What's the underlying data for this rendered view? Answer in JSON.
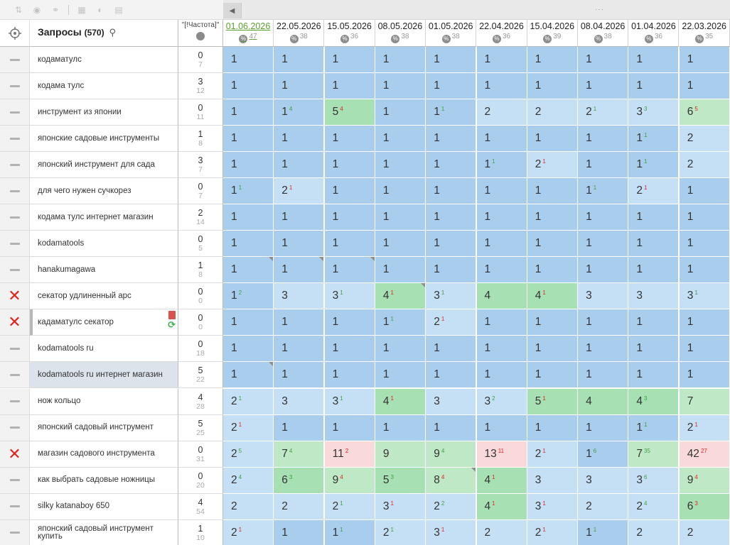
{
  "header": {
    "query_title": "Запросы",
    "query_count": "(570)",
    "freq_label": "\"[!Частота]\""
  },
  "dates": [
    {
      "label": "01.06.2026",
      "sub": "47",
      "active": true
    },
    {
      "label": "22.05.2026",
      "sub": "38"
    },
    {
      "label": "15.05.2026",
      "sub": "36"
    },
    {
      "label": "08.05.2026",
      "sub": "38"
    },
    {
      "label": "01.05.2026",
      "sub": "38"
    },
    {
      "label": "22.04.2026",
      "sub": "36"
    },
    {
      "label": "15.04.2026",
      "sub": "39"
    },
    {
      "label": "08.04.2026",
      "sub": "38"
    },
    {
      "label": "01.04.2026",
      "sub": "36"
    },
    {
      "label": "22.03.2026",
      "sub": "35"
    }
  ],
  "pct_symbol": "%",
  "colors": {
    "blue_dark": "#a9cdec",
    "blue_light": "#c5e0f5",
    "green": "#a7e0b3",
    "pink": "#f9d9d9",
    "active_date": "#5aa02c",
    "delete": "#e0211d"
  },
  "rows": [
    {
      "mark": "dash",
      "query": "кодаматулс",
      "f1": "0",
      "f2": "7",
      "cells": [
        [
          "1",
          "",
          "",
          "b1"
        ],
        [
          "1",
          "",
          "",
          "b1"
        ],
        [
          "1",
          "",
          "",
          "b1"
        ],
        [
          "1",
          "",
          "",
          "b1"
        ],
        [
          "1",
          "",
          "",
          "b1"
        ],
        [
          "1",
          "",
          "",
          "b1"
        ],
        [
          "1",
          "",
          "",
          "b1"
        ],
        [
          "1",
          "",
          "",
          "b1"
        ],
        [
          "1",
          "",
          "",
          "b1"
        ],
        [
          "1",
          "",
          "",
          "b1"
        ]
      ]
    },
    {
      "mark": "dash",
      "query": "кодама тулс",
      "f1": "3",
      "f2": "12",
      "cells": [
        [
          "1",
          "",
          "",
          "b1"
        ],
        [
          "1",
          "",
          "",
          "b1"
        ],
        [
          "1",
          "",
          "",
          "b1"
        ],
        [
          "1",
          "",
          "",
          "b1"
        ],
        [
          "1",
          "",
          "",
          "b1"
        ],
        [
          "1",
          "",
          "",
          "b1"
        ],
        [
          "1",
          "",
          "",
          "b1"
        ],
        [
          "1",
          "",
          "",
          "b1"
        ],
        [
          "1",
          "",
          "",
          "b1"
        ],
        [
          "1",
          "",
          "",
          "b1"
        ]
      ]
    },
    {
      "mark": "dash",
      "query": "инструмент из японии",
      "f1": "0",
      "f2": "11",
      "cells": [
        [
          "1",
          "",
          "",
          "b1"
        ],
        [
          "1",
          "4",
          "up",
          "b1"
        ],
        [
          "5",
          "4",
          "dn",
          "g1"
        ],
        [
          "1",
          "",
          "",
          "b1"
        ],
        [
          "1",
          "1",
          "up",
          "b1"
        ],
        [
          "2",
          "",
          "",
          "b3"
        ],
        [
          "2",
          "",
          "",
          "b3"
        ],
        [
          "2",
          "1",
          "up",
          "b3"
        ],
        [
          "3",
          "3",
          "up",
          "b3"
        ],
        [
          "6",
          "5",
          "dn",
          "g2"
        ]
      ]
    },
    {
      "mark": "dash",
      "query": "японские садовые инструменты",
      "f1": "1",
      "f2": "8",
      "cells": [
        [
          "1",
          "",
          "",
          "b1"
        ],
        [
          "1",
          "",
          "",
          "b1"
        ],
        [
          "1",
          "",
          "",
          "b1"
        ],
        [
          "1",
          "",
          "",
          "b1"
        ],
        [
          "1",
          "",
          "",
          "b1"
        ],
        [
          "1",
          "",
          "",
          "b1"
        ],
        [
          "1",
          "",
          "",
          "b1"
        ],
        [
          "1",
          "",
          "",
          "b1"
        ],
        [
          "1",
          "1",
          "up",
          "b1"
        ],
        [
          "2",
          "",
          "",
          "b3"
        ]
      ]
    },
    {
      "mark": "dash",
      "query": "японский инструмент для сада",
      "f1": "3",
      "f2": "7",
      "cells": [
        [
          "1",
          "",
          "",
          "b1"
        ],
        [
          "1",
          "",
          "",
          "b1"
        ],
        [
          "1",
          "",
          "",
          "b1"
        ],
        [
          "1",
          "",
          "",
          "b1"
        ],
        [
          "1",
          "",
          "",
          "b1"
        ],
        [
          "1",
          "1",
          "up",
          "b1"
        ],
        [
          "2",
          "1",
          "dn",
          "b3"
        ],
        [
          "1",
          "",
          "",
          "b1"
        ],
        [
          "1",
          "1",
          "up",
          "b1"
        ],
        [
          "2",
          "",
          "",
          "b3"
        ]
      ]
    },
    {
      "mark": "dash",
      "query": "для чего нужен сучкорез",
      "f1": "0",
      "f2": "7",
      "cells": [
        [
          "1",
          "1",
          "up",
          "b1"
        ],
        [
          "2",
          "1",
          "dn",
          "b3"
        ],
        [
          "1",
          "",
          "",
          "b1"
        ],
        [
          "1",
          "",
          "",
          "b1"
        ],
        [
          "1",
          "",
          "",
          "b1"
        ],
        [
          "1",
          "",
          "",
          "b1"
        ],
        [
          "1",
          "",
          "",
          "b1"
        ],
        [
          "1",
          "1",
          "up",
          "b1"
        ],
        [
          "2",
          "1",
          "dn",
          "b3"
        ],
        [
          "1",
          "",
          "",
          "b1"
        ]
      ]
    },
    {
      "mark": "dash",
      "query": "кодама тулс интернет магазин",
      "f1": "2",
      "f2": "14",
      "cells": [
        [
          "1",
          "",
          "",
          "b1"
        ],
        [
          "1",
          "",
          "",
          "b1"
        ],
        [
          "1",
          "",
          "",
          "b1"
        ],
        [
          "1",
          "",
          "",
          "b1"
        ],
        [
          "1",
          "",
          "",
          "b1"
        ],
        [
          "1",
          "",
          "",
          "b1"
        ],
        [
          "1",
          "",
          "",
          "b1"
        ],
        [
          "1",
          "",
          "",
          "b1"
        ],
        [
          "1",
          "",
          "",
          "b1"
        ],
        [
          "1",
          "",
          "",
          "b1"
        ]
      ]
    },
    {
      "mark": "dash",
      "query": "kodamatools",
      "f1": "0",
      "f2": "5",
      "cells": [
        [
          "1",
          "",
          "",
          "b1"
        ],
        [
          "1",
          "",
          "",
          "b1"
        ],
        [
          "1",
          "",
          "",
          "b1"
        ],
        [
          "1",
          "",
          "",
          "b1"
        ],
        [
          "1",
          "",
          "",
          "b1"
        ],
        [
          "1",
          "",
          "",
          "b1"
        ],
        [
          "1",
          "",
          "",
          "b1"
        ],
        [
          "1",
          "",
          "",
          "b1"
        ],
        [
          "1",
          "",
          "",
          "b1"
        ],
        [
          "1",
          "",
          "",
          "b1"
        ]
      ]
    },
    {
      "mark": "dash",
      "query": "hanakumagawa",
      "f1": "1",
      "f2": "8",
      "cells": [
        [
          "1",
          "",
          "",
          "b1",
          1
        ],
        [
          "1",
          "",
          "",
          "b1",
          1
        ],
        [
          "1",
          "",
          "",
          "b1",
          1
        ],
        [
          "1",
          "",
          "",
          "b1"
        ],
        [
          "1",
          "",
          "",
          "b1"
        ],
        [
          "1",
          "",
          "",
          "b1"
        ],
        [
          "1",
          "",
          "",
          "b1"
        ],
        [
          "1",
          "",
          "",
          "b1"
        ],
        [
          "1",
          "",
          "",
          "b1"
        ],
        [
          "1",
          "",
          "",
          "b1"
        ]
      ]
    },
    {
      "mark": "x",
      "query": "секатор удлиненный арс",
      "f1": "0",
      "f2": "0",
      "cells": [
        [
          "1",
          "2",
          "up",
          "b1"
        ],
        [
          "3",
          "",
          "",
          "b3"
        ],
        [
          "3",
          "1",
          "up",
          "b3"
        ],
        [
          "4",
          "1",
          "dn",
          "g1",
          1
        ],
        [
          "3",
          "1",
          "up",
          "b3"
        ],
        [
          "4",
          "",
          "",
          "g1"
        ],
        [
          "4",
          "1",
          "dn",
          "g1"
        ],
        [
          "3",
          "",
          "",
          "b3"
        ],
        [
          "3",
          "",
          "",
          "b3"
        ],
        [
          "3",
          "1",
          "up",
          "b3"
        ]
      ]
    },
    {
      "mark": "x",
      "query": "кадаматулс секатор",
      "f1": "0",
      "f2": "0",
      "bar": true,
      "icons": true,
      "cells": [
        [
          "1",
          "",
          "",
          "b1"
        ],
        [
          "1",
          "",
          "",
          "b1"
        ],
        [
          "1",
          "",
          "",
          "b1"
        ],
        [
          "1",
          "1",
          "up",
          "b1"
        ],
        [
          "2",
          "1",
          "dn",
          "b3"
        ],
        [
          "1",
          "",
          "",
          "b1"
        ],
        [
          "1",
          "",
          "",
          "b1"
        ],
        [
          "1",
          "",
          "",
          "b1"
        ],
        [
          "1",
          "",
          "",
          "b1"
        ],
        [
          "1",
          "",
          "",
          "b1"
        ]
      ]
    },
    {
      "mark": "dash",
      "query": "kodamatools ru",
      "f1": "0",
      "f2": "18",
      "cells": [
        [
          "1",
          "",
          "",
          "b1"
        ],
        [
          "1",
          "",
          "",
          "b1"
        ],
        [
          "1",
          "",
          "",
          "b1"
        ],
        [
          "1",
          "",
          "",
          "b1"
        ],
        [
          "1",
          "",
          "",
          "b1"
        ],
        [
          "1",
          "",
          "",
          "b1"
        ],
        [
          "1",
          "",
          "",
          "b1"
        ],
        [
          "1",
          "",
          "",
          "b1"
        ],
        [
          "1",
          "",
          "",
          "b1"
        ],
        [
          "1",
          "",
          "",
          "b1"
        ]
      ]
    },
    {
      "mark": "dash",
      "query": "kodamatools ru интернет магазин",
      "f1": "5",
      "f2": "22",
      "sel": true,
      "cells": [
        [
          "1",
          "",
          "",
          "b1",
          1
        ],
        [
          "1",
          "",
          "",
          "b1"
        ],
        [
          "1",
          "",
          "",
          "b1"
        ],
        [
          "1",
          "",
          "",
          "b1"
        ],
        [
          "1",
          "",
          "",
          "b1"
        ],
        [
          "1",
          "",
          "",
          "b1"
        ],
        [
          "1",
          "",
          "",
          "b1"
        ],
        [
          "1",
          "",
          "",
          "b1"
        ],
        [
          "1",
          "",
          "",
          "b1"
        ],
        [
          "1",
          "",
          "",
          "b1"
        ]
      ]
    },
    {
      "mark": "dash",
      "query": "нож кольцо",
      "f1": "4",
      "f2": "28",
      "cells": [
        [
          "2",
          "1",
          "up",
          "b3"
        ],
        [
          "3",
          "",
          "",
          "b3"
        ],
        [
          "3",
          "1",
          "up",
          "b3"
        ],
        [
          "4",
          "1",
          "dn",
          "g1"
        ],
        [
          "3",
          "",
          "",
          "b3"
        ],
        [
          "3",
          "2",
          "up",
          "b3"
        ],
        [
          "5",
          "1",
          "dn",
          "g1"
        ],
        [
          "4",
          "",
          "",
          "g1"
        ],
        [
          "4",
          "3",
          "up",
          "g1"
        ],
        [
          "7",
          "",
          "",
          "g2"
        ]
      ]
    },
    {
      "mark": "dash",
      "query": "японский садовый инструмент",
      "f1": "5",
      "f2": "25",
      "cells": [
        [
          "2",
          "1",
          "dn",
          "b3"
        ],
        [
          "1",
          "",
          "",
          "b1"
        ],
        [
          "1",
          "",
          "",
          "b1"
        ],
        [
          "1",
          "",
          "",
          "b1"
        ],
        [
          "1",
          "",
          "",
          "b1"
        ],
        [
          "1",
          "",
          "",
          "b1"
        ],
        [
          "1",
          "",
          "",
          "b1"
        ],
        [
          "1",
          "",
          "",
          "b1"
        ],
        [
          "1",
          "1",
          "up",
          "b1"
        ],
        [
          "2",
          "1",
          "dn",
          "b3"
        ]
      ]
    },
    {
      "mark": "x",
      "query": "магазин садового инструмента",
      "f1": "0",
      "f2": "31",
      "cells": [
        [
          "2",
          "5",
          "up",
          "b3"
        ],
        [
          "7",
          "4",
          "up",
          "g2"
        ],
        [
          "11",
          "2",
          "dn",
          "pk"
        ],
        [
          "9",
          "",
          "",
          "g2"
        ],
        [
          "9",
          "4",
          "up",
          "g2"
        ],
        [
          "13",
          "11",
          "dn",
          "pk"
        ],
        [
          "2",
          "1",
          "dn",
          "b3"
        ],
        [
          "1",
          "6",
          "up",
          "b1"
        ],
        [
          "7",
          "35",
          "up",
          "g2"
        ],
        [
          "42",
          "27",
          "dn",
          "pk"
        ]
      ]
    },
    {
      "mark": "dash",
      "query": "как выбрать садовые ножницы",
      "f1": "0",
      "f2": "20",
      "cells": [
        [
          "2",
          "4",
          "up",
          "b3"
        ],
        [
          "6",
          "3",
          "up",
          "g1"
        ],
        [
          "9",
          "4",
          "dn",
          "g2"
        ],
        [
          "5",
          "3",
          "up",
          "g1"
        ],
        [
          "8",
          "4",
          "dn",
          "g2",
          1
        ],
        [
          "4",
          "1",
          "dn",
          "g1"
        ],
        [
          "3",
          "",
          "",
          "b3"
        ],
        [
          "3",
          "",
          "",
          "b3"
        ],
        [
          "3",
          "6",
          "up",
          "b3"
        ],
        [
          "9",
          "4",
          "dn",
          "g2"
        ]
      ]
    },
    {
      "mark": "dash",
      "query": "silky katanaboy 650",
      "f1": "4",
      "f2": "54",
      "cells": [
        [
          "2",
          "",
          "",
          "b3"
        ],
        [
          "2",
          "",
          "",
          "b3"
        ],
        [
          "2",
          "1",
          "up",
          "b3"
        ],
        [
          "3",
          "1",
          "dn",
          "b3"
        ],
        [
          "2",
          "2",
          "up",
          "b3"
        ],
        [
          "4",
          "1",
          "dn",
          "g1"
        ],
        [
          "3",
          "1",
          "dn",
          "b3"
        ],
        [
          "2",
          "",
          "",
          "b3"
        ],
        [
          "2",
          "4",
          "up",
          "b3"
        ],
        [
          "6",
          "3",
          "dn",
          "g1"
        ]
      ]
    },
    {
      "mark": "dash",
      "query": "японский садовый инструмент купить",
      "f1": "1",
      "f2": "10",
      "cells": [
        [
          "2",
          "1",
          "dn",
          "b3"
        ],
        [
          "1",
          "",
          "",
          "b1"
        ],
        [
          "1",
          "1",
          "up",
          "b1"
        ],
        [
          "2",
          "1",
          "up",
          "b3"
        ],
        [
          "3",
          "1",
          "dn",
          "b3"
        ],
        [
          "2",
          "",
          "",
          "b3"
        ],
        [
          "2",
          "1",
          "dn",
          "b3"
        ],
        [
          "1",
          "1",
          "up",
          "b1"
        ],
        [
          "2",
          "",
          "",
          "b3"
        ],
        [
          "2",
          "",
          "",
          "b3"
        ]
      ]
    }
  ]
}
